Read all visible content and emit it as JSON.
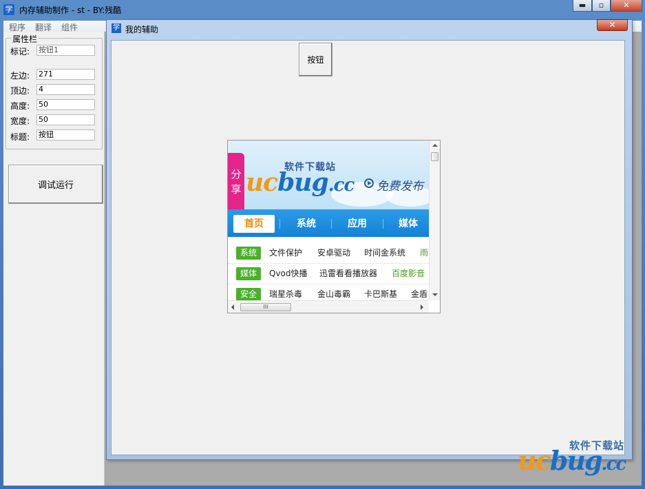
{
  "window": {
    "title": "内存辅助制作 - st - BY:残酷",
    "app_icon": "学",
    "minimize_label": "▬",
    "maximize_label": "▫",
    "close_label": "✕"
  },
  "menu": [
    "程序",
    "翻译",
    "组件"
  ],
  "properties": {
    "group_title": "属性栏",
    "rows": [
      {
        "label": "标记:",
        "value": "按钮1"
      },
      {
        "label": "左边:",
        "value": "271"
      },
      {
        "label": "顶边:",
        "value": "4"
      },
      {
        "label": "高度:",
        "value": "50"
      },
      {
        "label": "宽度:",
        "value": "50"
      },
      {
        "label": "标题:",
        "value": "按钮"
      }
    ]
  },
  "run_button": "调试运行",
  "child_window": {
    "title": "我的辅助",
    "icon": "学",
    "close_label": "✕"
  },
  "form_button_label": "按钮",
  "browser": {
    "share_tab": "分享",
    "site_title": "软件下载站",
    "logo_left": "uc",
    "logo_mid": "bug",
    "logo_right": ".cc",
    "slogan": "免费发布",
    "nav": [
      "首页",
      "系统",
      "应用",
      "媒体"
    ],
    "categories": [
      {
        "badge": "系统",
        "links": [
          "文件保护",
          "安卓驱动",
          "时间金系统",
          "雨"
        ]
      },
      {
        "badge": "媒体",
        "links": [
          "Qvod快播",
          "迅雷看看播放器",
          "百度影音"
        ]
      },
      {
        "badge": "安全",
        "links": [
          "瑞星杀毒",
          "金山毒霸",
          "卡巴斯基",
          "金盾"
        ]
      }
    ],
    "hscroll_grip": "III",
    "accent_color": "#1381d6",
    "badge_color": "#4bb02a",
    "share_color": "#e52489"
  },
  "watermark": {
    "title": "软件下载站",
    "logo_left": "uc",
    "logo_mid": "bug",
    "logo_right": ".cc"
  }
}
